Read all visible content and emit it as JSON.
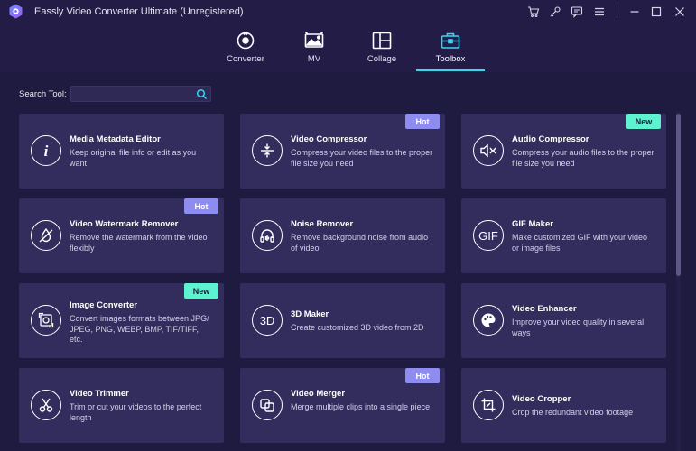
{
  "window": {
    "title": "Eassly Video Converter Ultimate (Unregistered)"
  },
  "nav": {
    "tabs": [
      {
        "label": "Converter",
        "icon": "convert-icon"
      },
      {
        "label": "MV",
        "icon": "image-icon"
      },
      {
        "label": "Collage",
        "icon": "collage-icon"
      },
      {
        "label": "Toolbox",
        "icon": "toolbox-icon",
        "active": true
      }
    ]
  },
  "search": {
    "label": "Search Tool:",
    "value": "",
    "placeholder": ""
  },
  "tools": [
    {
      "title": "Media Metadata Editor",
      "desc": "Keep original file info or edit as you want",
      "icon": "info-icon",
      "badge": ""
    },
    {
      "title": "Video Compressor",
      "desc": "Compress your video files to the proper file size you need",
      "icon": "compress-icon",
      "badge": "Hot"
    },
    {
      "title": "Audio Compressor",
      "desc": "Compress your audio files to the proper file size you need",
      "icon": "audio-compress-icon",
      "badge": "New"
    },
    {
      "title": "Video Watermark Remover",
      "desc": "Remove the watermark from the video flexibly",
      "icon": "watermark-icon",
      "badge": "Hot"
    },
    {
      "title": "Noise Remover",
      "desc": "Remove background noise from audio of video",
      "icon": "headphones-icon",
      "badge": ""
    },
    {
      "title": "GIF Maker",
      "desc": "Make customized GIF with your video or image files",
      "icon": "gif-icon",
      "badge": "",
      "icon_text": "GIF"
    },
    {
      "title": "Image Converter",
      "desc": "Convert images formats between JPG/ JPEG, PNG, WEBP, BMP, TIF/TIFF, etc.",
      "icon": "image-convert-icon",
      "badge": "New"
    },
    {
      "title": "3D Maker",
      "desc": "Create customized 3D video from 2D",
      "icon": "3d-icon",
      "badge": "",
      "icon_text": "3D"
    },
    {
      "title": "Video Enhancer",
      "desc": "Improve your video quality in several ways",
      "icon": "palette-icon",
      "badge": ""
    },
    {
      "title": "Video Trimmer",
      "desc": "Trim or cut your videos to the perfect length",
      "icon": "scissors-icon",
      "badge": ""
    },
    {
      "title": "Video Merger",
      "desc": "Merge multiple clips into a single piece",
      "icon": "merge-icon",
      "badge": "Hot"
    },
    {
      "title": "Video Cropper",
      "desc": "Crop the redundant video footage",
      "icon": "crop-icon",
      "badge": ""
    }
  ],
  "colors": {
    "background": "#221c46",
    "card": "#322d5d",
    "accent": "#37d6f1",
    "hot_badge": "#8f8cf0",
    "new_badge": "#5ff2d0"
  }
}
